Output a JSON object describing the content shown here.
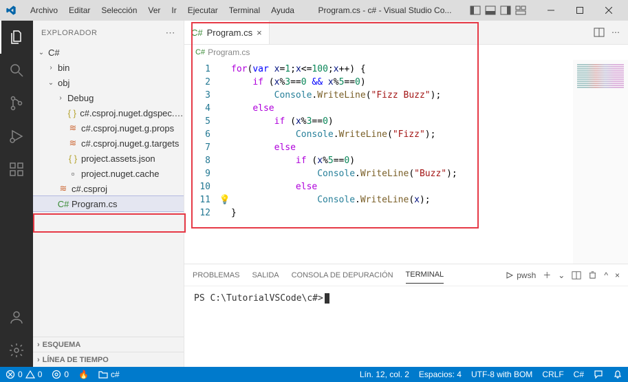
{
  "titlebar": {
    "menus": [
      "Archivo",
      "Editar",
      "Selección",
      "Ver",
      "Ir",
      "Ejecutar",
      "Terminal",
      "Ayuda"
    ],
    "title": "Program.cs - c# - Visual Studio Co..."
  },
  "sidebar": {
    "header": "EXPLORADOR",
    "root": "C#",
    "items": [
      {
        "label": "bin",
        "kind": "folder",
        "depth": 1,
        "expanded": false
      },
      {
        "label": "obj",
        "kind": "folder",
        "depth": 1,
        "expanded": true
      },
      {
        "label": "Debug",
        "kind": "folder",
        "depth": 2,
        "expanded": false
      },
      {
        "label": "c#.csproj.nuget.dgspec.json",
        "kind": "json",
        "depth": 2
      },
      {
        "label": "c#.csproj.nuget.g.props",
        "kind": "rss",
        "depth": 2
      },
      {
        "label": "c#.csproj.nuget.g.targets",
        "kind": "rss",
        "depth": 2
      },
      {
        "label": "project.assets.json",
        "kind": "json",
        "depth": 2
      },
      {
        "label": "project.nuget.cache",
        "kind": "file",
        "depth": 2
      },
      {
        "label": "c#.csproj",
        "kind": "rss",
        "depth": 1
      },
      {
        "label": "Program.cs",
        "kind": "cs",
        "depth": 1,
        "selected": true
      }
    ],
    "sections": [
      "ESQUEMA",
      "LÍNEA DE TIEMPO"
    ]
  },
  "editor": {
    "tab": {
      "label": "Program.cs"
    },
    "breadcrumb": "Program.cs",
    "lines": [
      {
        "n": 1,
        "html": "<span class='tk-ctrl'>for</span><span class='tk-pun'>(</span><span class='tk-kw'>var</span> <span class='tk-var'>x</span>=<span class='tk-num'>1</span>;<span class='tk-var'>x</span>&lt;=<span class='tk-num'>100</span>;<span class='tk-var'>x</span>++) {"
      },
      {
        "n": 2,
        "html": "    <span class='tk-ctrl'>if</span> (<span class='tk-var'>x</span>%<span class='tk-num'>3</span>==<span class='tk-num'>0</span> <span class='tk-kw'>&amp;&amp;</span> <span class='tk-var'>x</span>%<span class='tk-num'>5</span>==<span class='tk-num'>0</span>)"
      },
      {
        "n": 3,
        "html": "        <span class='tk-cls'>Console</span>.<span class='tk-fn'>WriteLine</span>(<span class='tk-str'>\"Fizz Buzz\"</span>);"
      },
      {
        "n": 4,
        "html": "    <span class='tk-ctrl'>else</span>"
      },
      {
        "n": 5,
        "html": "        <span class='tk-ctrl'>if</span> (<span class='tk-var'>x</span>%<span class='tk-num'>3</span>==<span class='tk-num'>0</span>)"
      },
      {
        "n": 6,
        "html": "            <span class='tk-cls'>Console</span>.<span class='tk-fn'>WriteLine</span>(<span class='tk-str'>\"Fizz\"</span>);"
      },
      {
        "n": 7,
        "html": "        <span class='tk-ctrl'>else</span>"
      },
      {
        "n": 8,
        "html": "            <span class='tk-ctrl'>if</span> (<span class='tk-var'>x</span>%<span class='tk-num'>5</span>==<span class='tk-num'>0</span>)"
      },
      {
        "n": 9,
        "html": "                <span class='tk-cls'>Console</span>.<span class='tk-fn'>WriteLine</span>(<span class='tk-str'>\"Buzz\"</span>);"
      },
      {
        "n": 10,
        "html": "            <span class='tk-ctrl'>else</span>"
      },
      {
        "n": 11,
        "html": "                <span class='tk-cls'>Console</span>.<span class='tk-fn'>WriteLine</span>(<span class='tk-var'>x</span>);",
        "bulb": true
      },
      {
        "n": 12,
        "html": "}"
      }
    ]
  },
  "panel": {
    "tabs": [
      "PROBLEMAS",
      "SALIDA",
      "CONSOLA DE DEPURACIÓN",
      "TERMINAL"
    ],
    "active": 3,
    "shell": "pwsh",
    "prompt": "PS C:\\TutorialVSCode\\c#>"
  },
  "statusbar": {
    "errors": "0",
    "warnings": "0",
    "port": "0",
    "branch": "c#",
    "position": "Lín. 12, col. 2",
    "spaces": "Espacios: 4",
    "encoding": "UTF-8 with BOM",
    "eol": "CRLF",
    "lang": "C#"
  }
}
